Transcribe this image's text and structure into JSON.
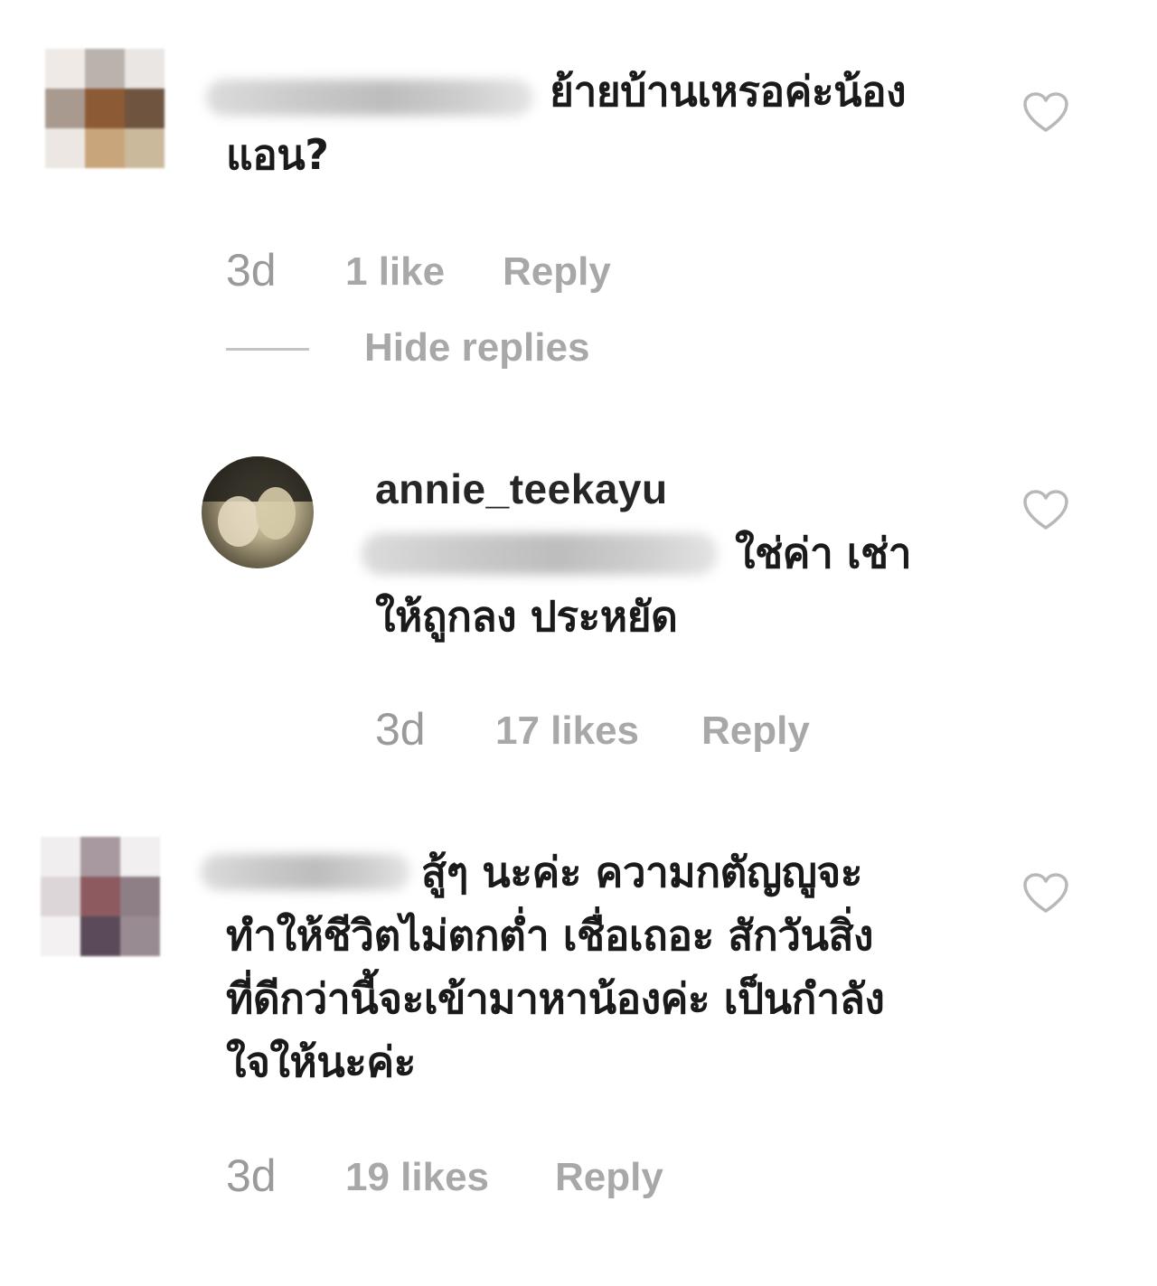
{
  "colors": {
    "text": "#1a1a1a",
    "meta": "#a8a8a8",
    "heart": "#b8b8b8",
    "divider": "#c4c4c4"
  },
  "comments": [
    {
      "avatar": "pixelated-avatar",
      "username_hidden": true,
      "text_lines": [
        "ย้ายบ้านเหรอค่ะน้อง",
        "แอน?"
      ],
      "time": "3d",
      "likes": "1 like",
      "reply": "Reply",
      "hide_replies": "Hide replies",
      "replies": [
        {
          "username": "annie_teekayu",
          "text_lines": [
            "ใช่ค่า เช่า",
            "ให้ถูกลง ประหยัด"
          ],
          "time": "3d",
          "likes": "17 likes",
          "reply": "Reply"
        }
      ]
    },
    {
      "avatar": "pixelated-avatar",
      "username_hidden": true,
      "text_lines": [
        "สู้ๆ นะค่ะ ความกตัญญูจะ",
        "ทำให้ชีวิตไม่ตกต่ำ เชื่อเถอะ สักวันสิ่ง",
        "ที่ดีกว่านี้จะเข้ามาหาน้องค่ะ เป็นกำลัง",
        "ใจให้นะค่ะ"
      ],
      "time": "3d",
      "likes": "19 likes",
      "reply": "Reply"
    }
  ],
  "icons": {
    "like": "heart-outline-icon"
  }
}
